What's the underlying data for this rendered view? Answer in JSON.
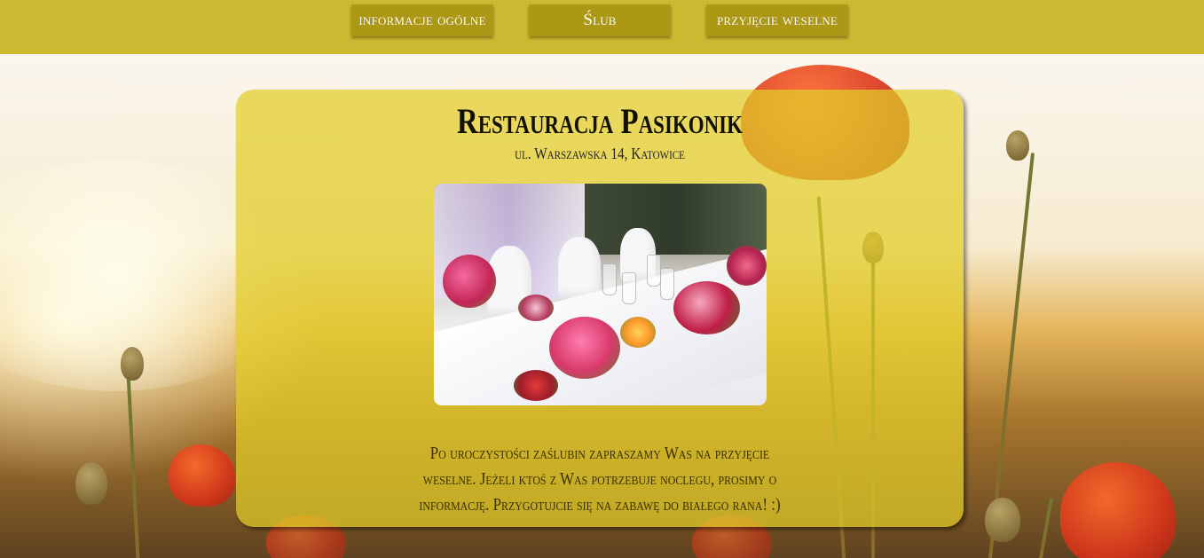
{
  "nav": {
    "items": [
      {
        "label": "informacje ogólne"
      },
      {
        "label": "Ślub"
      },
      {
        "label": "przyjęcie weselne"
      }
    ]
  },
  "card": {
    "title": "Restauracja Pasikonik",
    "address": "ul. Warszawska 14, Katowice",
    "description": "Po uroczystości zaślubin zapraszamy Was na przyjęcie weselne. Jeżeli ktoś z Was potrzebuje noclegu, prosimy o informację. Przygotujcie się na zabawę do białego rana! :)"
  },
  "colors": {
    "navbar": "#cdb831",
    "nav_button": "#ad9816",
    "card": "#e2cd28"
  },
  "icons": {
    "photo": "wedding-table-photo",
    "background": "poppy-field-background"
  }
}
